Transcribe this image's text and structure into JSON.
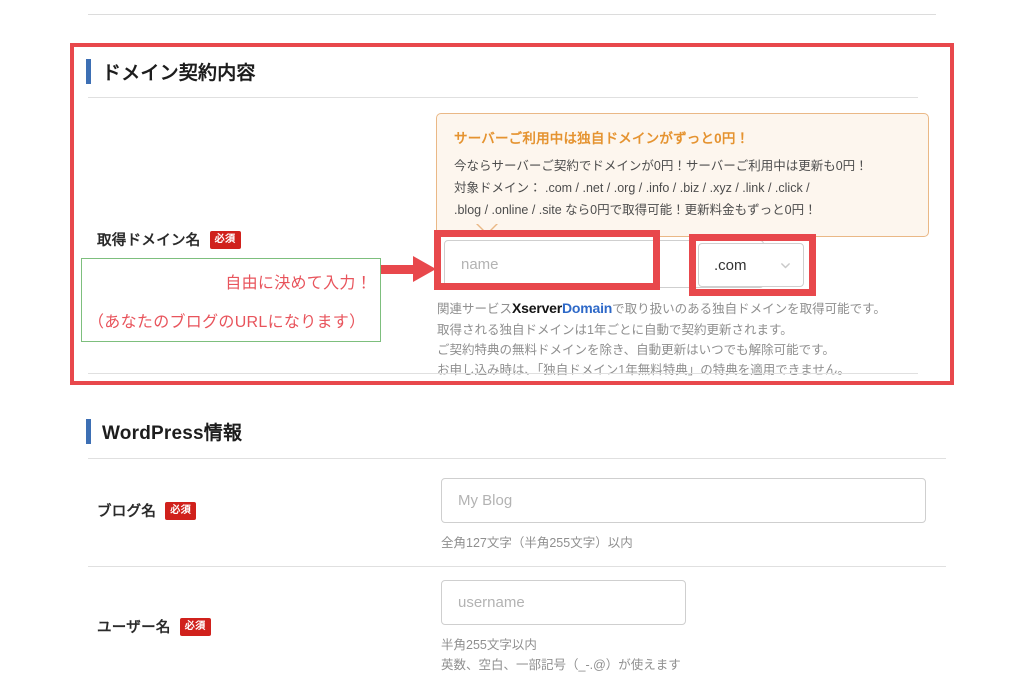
{
  "page": {
    "background": "#ffffff",
    "accent_blue": "#3d6fb4",
    "accent_red": "#e8484c",
    "badge_red": "#d0211c",
    "notice_orange": "#e59330",
    "callout_green": "#7dbf7d",
    "callout_text_red": "#e8545c"
  },
  "domain_section": {
    "title": "ドメイン契約内容",
    "notice": {
      "title": "サーバーご利用中は独自ドメインがずっと0円！",
      "body": "今ならサーバーご契約でドメインが0円！サーバーご利用中は更新も0円！\n対象ドメイン： .com / .net / .org / .info / .biz / .xyz / .link / .click /\n.blog / .online / .site なら0円で取得可能！更新料金もずっと0円！"
    },
    "field": {
      "label": "取得ドメイン名",
      "required_badge": "必須",
      "name_input": {
        "value": "",
        "placeholder": "name"
      },
      "tld_select": {
        "selected": ".com",
        "chevron": "chevron-down-icon"
      }
    },
    "callout": {
      "line1": "自由に決めて入力！",
      "line2": "（あなたのブログのURLになります）"
    },
    "note": {
      "line1_prefix": "関連サービス",
      "brand_black": "Xserver",
      "brand_blue": "Domain",
      "line1_suffix": "で取り扱いのある独自ドメインを取得可能です。",
      "line2": "取得される独自ドメインは1年ごとに自動で契約更新されます。",
      "line3": "ご契約特典の無料ドメインを除き、自動更新はいつでも解除可能です。",
      "line4": "お申し込み時は、「独自ドメイン1年無料特典」の特典を適用できません。"
    }
  },
  "wordpress_section": {
    "title": "WordPress情報",
    "fields": [
      {
        "label": "ブログ名",
        "required_badge": "必須",
        "input": {
          "value": "",
          "placeholder": "My Blog"
        },
        "help": "全角127文字（半角255文字）以内"
      },
      {
        "label": "ユーザー名",
        "required_badge": "必須",
        "input": {
          "value": "",
          "placeholder": "username"
        },
        "help": "半角255文字以内\n英数、空白、一部記号（_-.@）が使えます"
      }
    ]
  }
}
